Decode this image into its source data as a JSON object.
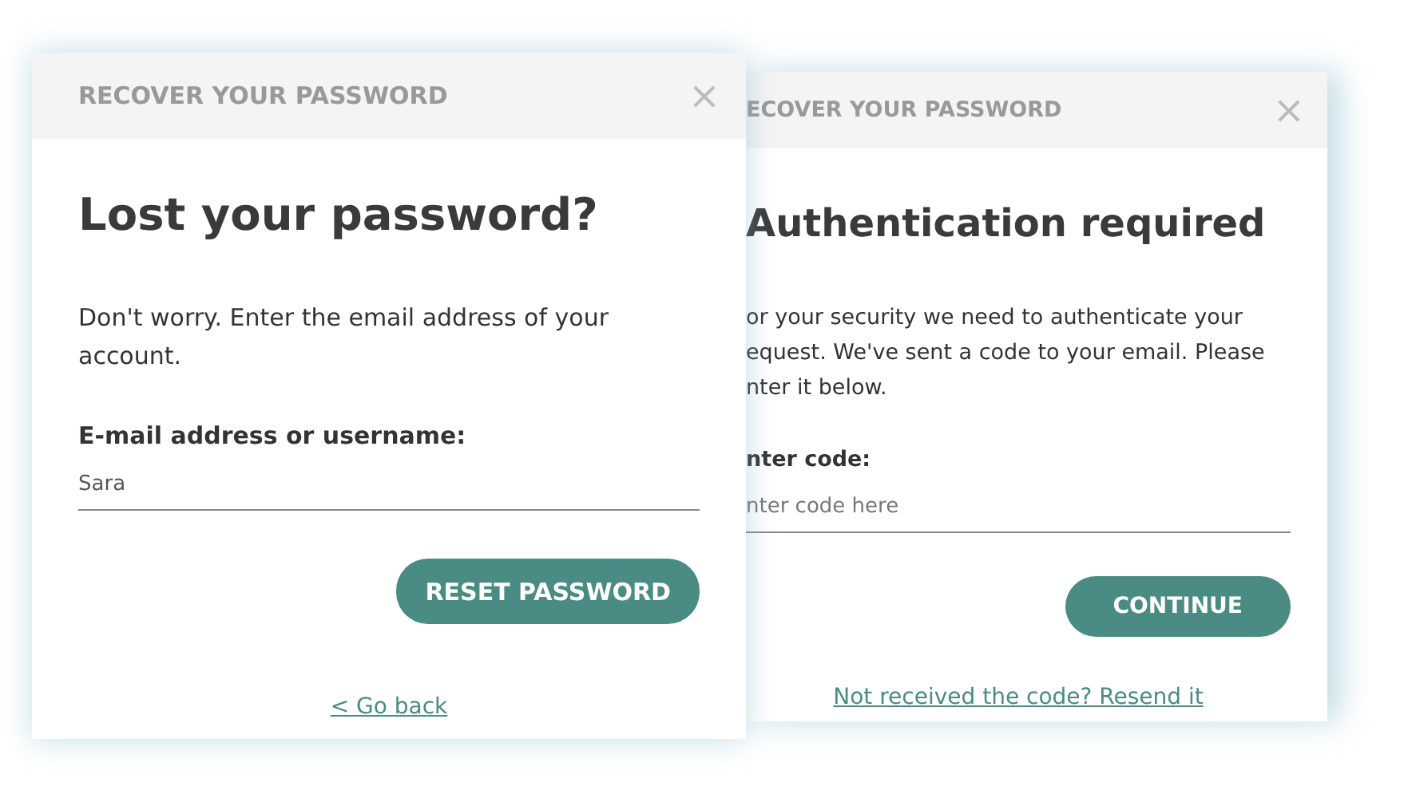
{
  "dialogs": [
    {
      "title": "RECOVER YOUR PASSWORD",
      "close": "×",
      "heading": "Lost your password?",
      "text": "Don't worry. Enter the email address of your\naccount.",
      "field_label": "E-mail address or username:",
      "field": {
        "value": "Sara"
      },
      "button": "RESET PASSWORD",
      "link": "< Go back"
    },
    {
      "title": "ECOVER YOUR PASSWORD",
      "close": "×",
      "heading": "Authentication required",
      "text": "or your security we need to authenticate your\nequest. We've sent a code to your email. Please\nnter it below.",
      "field_label": "nter code:",
      "field": {
        "placeholder": "nter code here"
      },
      "button": "CONTINUE",
      "link": "Not received the code? Resend it"
    }
  ]
}
